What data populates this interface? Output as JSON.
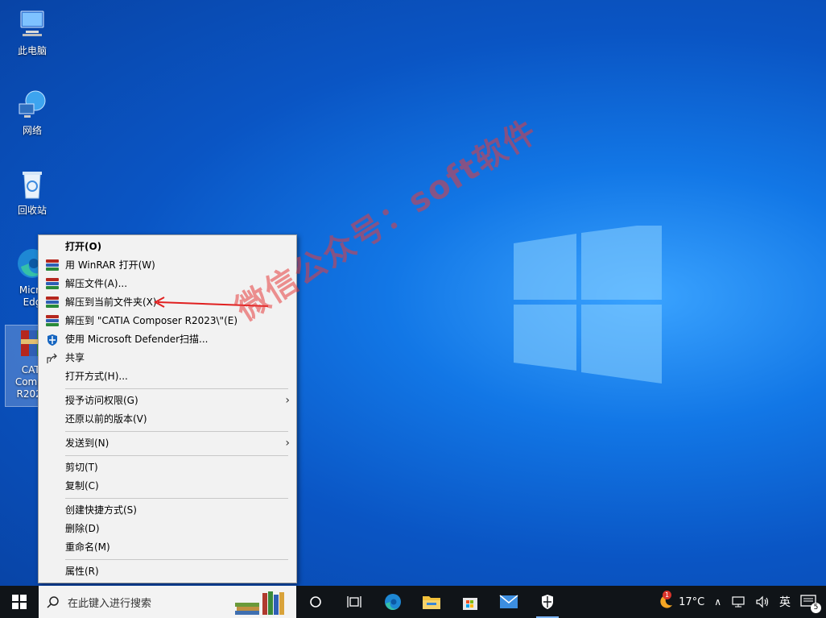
{
  "desktop": {
    "icons": [
      {
        "label": "此电脑"
      },
      {
        "label": "网络"
      },
      {
        "label": "回收站"
      },
      {
        "label": "Micro\nEdg"
      },
      {
        "label": "CATI\nCompo\nR2023"
      }
    ]
  },
  "context_menu": {
    "items": [
      {
        "label": "打开(O)"
      },
      {
        "label": "用 WinRAR 打开(W)"
      },
      {
        "label": "解压文件(A)..."
      },
      {
        "label": "解压到当前文件夹(X)"
      },
      {
        "label": "解压到 \"CATIA Composer R2023\\\"(E)"
      },
      {
        "label": "使用 Microsoft Defender扫描..."
      },
      {
        "label": "共享"
      },
      {
        "label": "打开方式(H)..."
      },
      {
        "label": "授予访问权限(G)"
      },
      {
        "label": "还原以前的版本(V)"
      },
      {
        "label": "发送到(N)"
      },
      {
        "label": "剪切(T)"
      },
      {
        "label": "复制(C)"
      },
      {
        "label": "创建快捷方式(S)"
      },
      {
        "label": "删除(D)"
      },
      {
        "label": "重命名(M)"
      },
      {
        "label": "属性(R)"
      }
    ]
  },
  "watermark": {
    "text": "微信公众号：soft软件"
  },
  "taskbar": {
    "search_placeholder": "在此键入进行搜索",
    "weather_temp": "17°C",
    "weather_badge": "1",
    "ime": "英",
    "notification_count": "5"
  },
  "colors": {
    "desktop_bg": "#0a55c4",
    "menu_bg": "#f2f2f2",
    "taskbar_bg": "#101418",
    "annotation_arrow": "#e02020",
    "watermark": "#e63c3c"
  },
  "icons_used": [
    "this-pc-icon",
    "network-icon",
    "recycle-bin-icon",
    "edge-icon",
    "winrar-archive-icon",
    "winrar-icon",
    "defender-shield-icon",
    "share-icon",
    "windows-start-icon",
    "search-icon",
    "task-view-icon",
    "cortana-icon",
    "edge-taskbar-icon",
    "file-explorer-icon",
    "store-icon",
    "mail-icon",
    "security-icon",
    "weather-icon",
    "network-tray-icon",
    "volume-icon",
    "notification-icon"
  ]
}
